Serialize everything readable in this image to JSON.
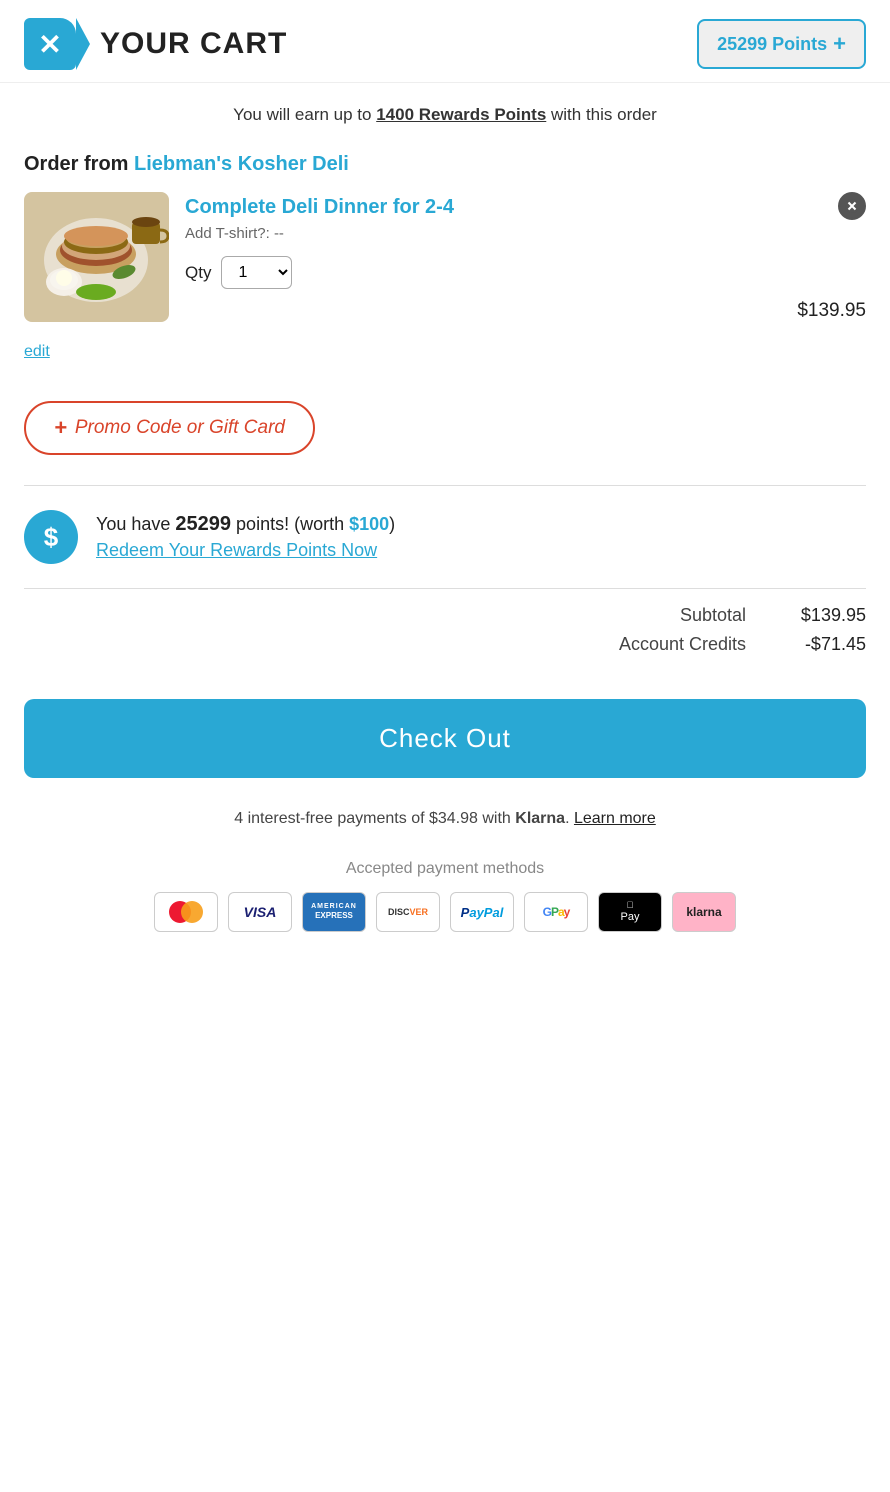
{
  "header": {
    "logo_icon": "x",
    "title": "YOUR CART",
    "points_label": "25299 Points",
    "points_plus": "+"
  },
  "earn_notice": {
    "prefix": "You will earn up to ",
    "points_text": "1400 Rewards Points",
    "suffix": " with this order"
  },
  "order": {
    "label": "Order from",
    "restaurant": "Liebman's Kosher Deli",
    "item": {
      "name": "Complete Deli Dinner for 2-4",
      "addon_label": "Add T-shirt?:",
      "addon_value": "--",
      "qty_label": "Qty",
      "qty_value": "1",
      "price": "$139.95",
      "edit_label": "edit"
    }
  },
  "promo": {
    "plus": "+",
    "label": "Promo Code or Gift Card"
  },
  "rewards": {
    "prefix": "You have ",
    "points": "25299",
    "middle": " points! (worth ",
    "worth": "$100",
    "suffix": ")",
    "redeem_label": "Redeem Your Rewards Points Now"
  },
  "totals": {
    "subtotal_label": "Subtotal",
    "subtotal_value": "$139.95",
    "credits_label": "Account Credits",
    "credits_value": "-$71.45"
  },
  "checkout": {
    "button_label": "Check Out"
  },
  "klarna": {
    "text_prefix": "4 interest-free payments of $34.98 with ",
    "brand": "Klarna",
    "text_suffix": ". ",
    "learn_more": "Learn more"
  },
  "payment": {
    "label": "Accepted payment methods",
    "methods": [
      {
        "name": "Mastercard",
        "key": "mastercard"
      },
      {
        "name": "Visa",
        "key": "visa"
      },
      {
        "name": "American Express",
        "key": "amex"
      },
      {
        "name": "Discover",
        "key": "discover"
      },
      {
        "name": "PayPal",
        "key": "paypal"
      },
      {
        "name": "Google Pay",
        "key": "gpay"
      },
      {
        "name": "Apple Pay",
        "key": "applepay"
      },
      {
        "name": "Klarna",
        "key": "klarna"
      }
    ]
  },
  "colors": {
    "accent": "#29a8d4",
    "promo_border": "#d9442a",
    "checkout_bg": "#29a8d4"
  }
}
